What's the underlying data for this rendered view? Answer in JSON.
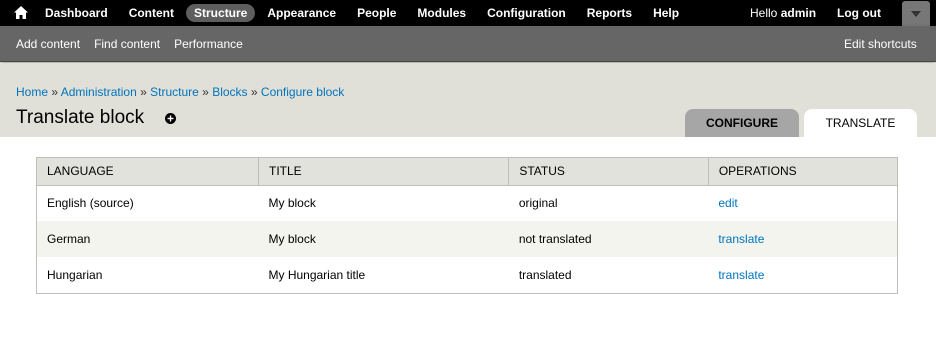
{
  "toolbar": {
    "menu": [
      "Dashboard",
      "Content",
      "Structure",
      "Appearance",
      "People",
      "Modules",
      "Configuration",
      "Reports",
      "Help"
    ],
    "active": "Structure",
    "hello_prefix": "Hello",
    "username": "admin",
    "logout": "Log out"
  },
  "shortcuts": {
    "items": [
      "Add content",
      "Find content",
      "Performance"
    ],
    "edit": "Edit shortcuts"
  },
  "breadcrumb": [
    "Home",
    "Administration",
    "Structure",
    "Blocks",
    "Configure block"
  ],
  "breadcrumb_separator": "»",
  "page_title": "Translate block",
  "tabs": {
    "configure": "Configure",
    "translate": "Translate"
  },
  "table": {
    "headers": [
      "Language",
      "Title",
      "Status",
      "Operations"
    ],
    "rows": [
      {
        "language": "English (source)",
        "title": "My block",
        "status": "original",
        "operation": "edit"
      },
      {
        "language": "German",
        "title": "My block",
        "status": "not translated",
        "operation": "translate"
      },
      {
        "language": "Hungarian",
        "title": "My Hungarian title",
        "status": "translated",
        "operation": "translate"
      }
    ]
  },
  "colors": {
    "toolbar_bg": "#000000",
    "shortcuts_bg": "#666666",
    "header_bg": "#e0e0d8",
    "link": "#0074bd"
  }
}
